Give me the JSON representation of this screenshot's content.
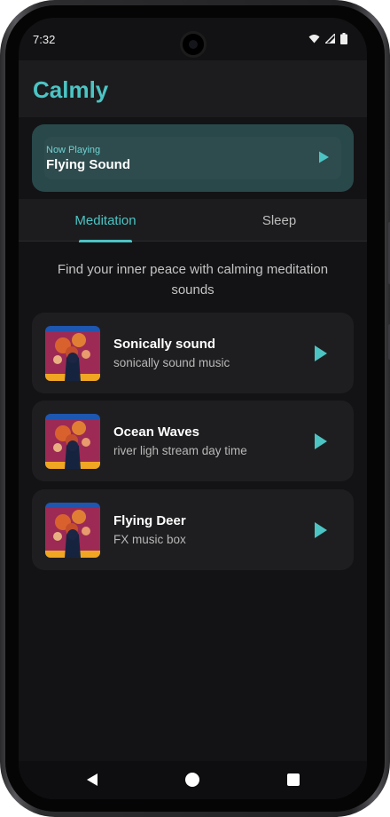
{
  "status_bar": {
    "time": "7:32",
    "icons": [
      "wifi-icon",
      "signal-icon",
      "battery-icon"
    ]
  },
  "app": {
    "title": "Calmly",
    "accent_color": "#4cc4c4"
  },
  "now_playing": {
    "label": "Now Playing",
    "title": "Flying Sound",
    "action_icon": "play-icon"
  },
  "tabs": [
    {
      "label": "Meditation",
      "selected": true
    },
    {
      "label": "Sleep",
      "selected": false
    }
  ],
  "description": "Find your inner peace with calming meditation sounds",
  "tracks": [
    {
      "title": "Sonically sound",
      "subtitle": "sonically sound music",
      "action_icon": "play-icon"
    },
    {
      "title": "Ocean Waves",
      "subtitle": "river ligh stream day time",
      "action_icon": "play-icon"
    },
    {
      "title": "Flying Deer",
      "subtitle": "FX music box",
      "action_icon": "play-icon"
    }
  ],
  "nav_bar": {
    "icons": [
      "back-icon",
      "home-icon",
      "recents-icon"
    ]
  }
}
